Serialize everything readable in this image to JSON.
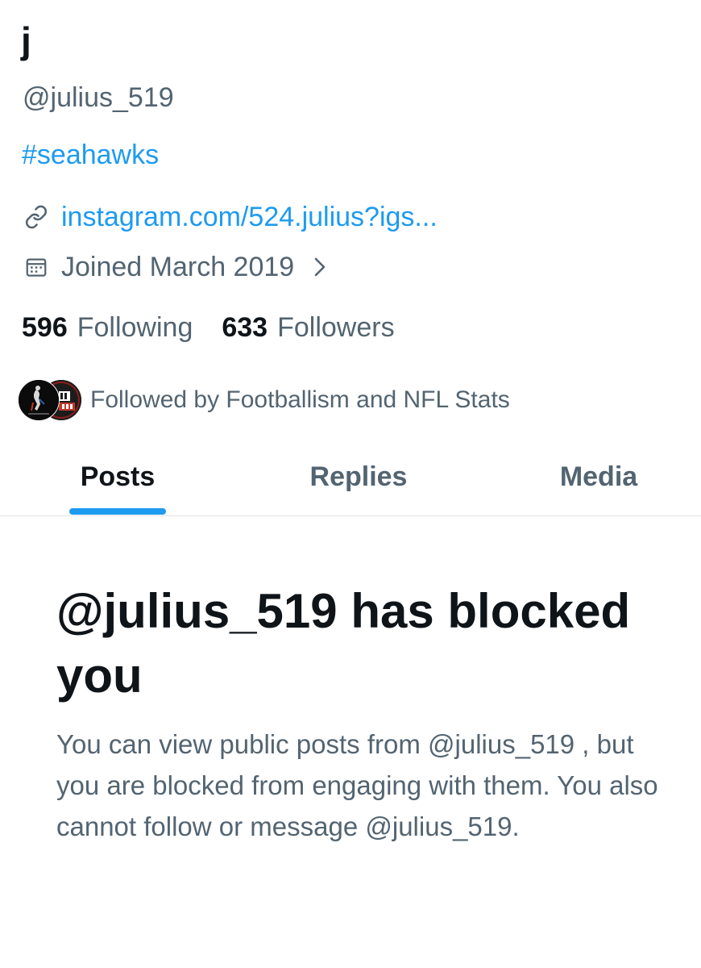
{
  "profile": {
    "display_name": "j",
    "handle": "@julius_519",
    "bio_hashtag": "#seahawks",
    "link_text": "instagram.com/524.julius?igs...",
    "joined_text": "Joined March 2019",
    "following_count": "596",
    "following_label": "Following",
    "followers_count": "633",
    "followers_label": "Followers",
    "followed_by_text": "Followed by Footballism and NFL Stats",
    "followed_by_avatars": [
      {
        "icon": "footballism-avatar"
      },
      {
        "icon": "nfl-stats-avatar"
      }
    ]
  },
  "tabs": [
    {
      "label": "Posts",
      "selected": true
    },
    {
      "label": "Replies",
      "selected": false
    },
    {
      "label": "Media",
      "selected": false
    }
  ],
  "blocked": {
    "title": "@julius_519 has blocked you",
    "body": "You can view public posts from @julius_519 , but you are blocked from engaging with them. You also cannot follow or message @julius_519."
  },
  "colors": {
    "accent": "#1d9bf0",
    "text_primary": "#0f1419",
    "text_secondary": "#536471",
    "divider": "#dfe3e6"
  },
  "icons": {
    "link": "link-icon",
    "calendar": "calendar-icon",
    "chevron": "chevron-right-icon"
  }
}
